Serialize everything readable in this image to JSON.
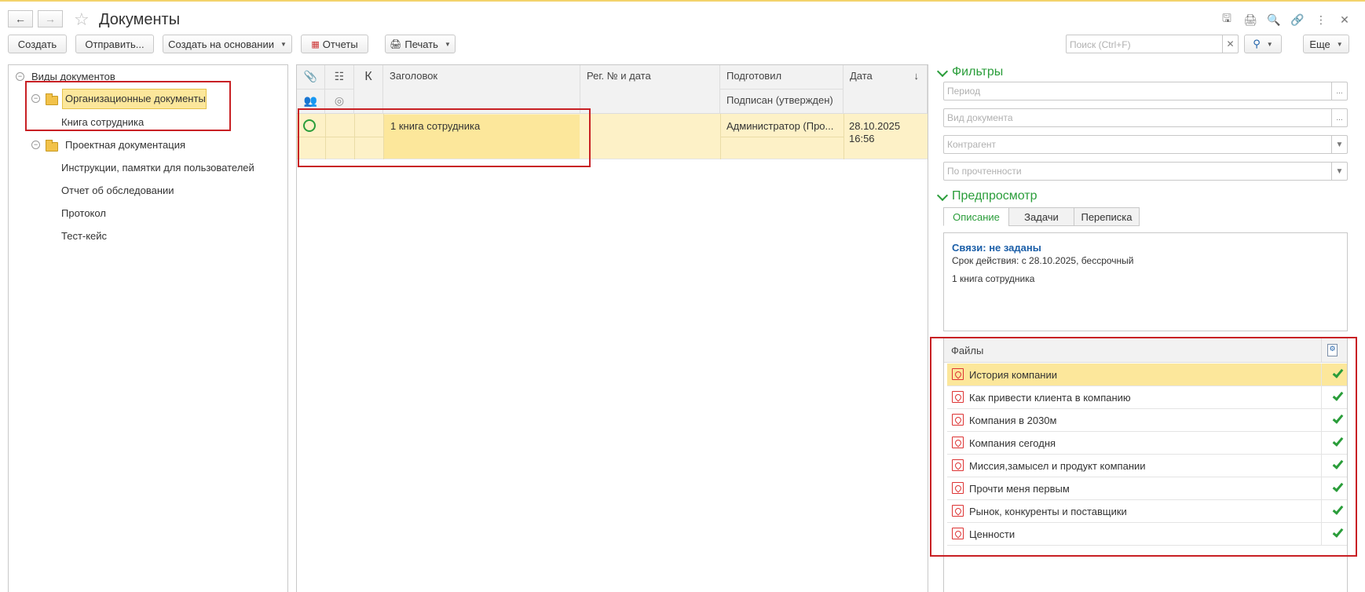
{
  "window": {
    "title": "Документы",
    "back_icon": "arrow-left-icon",
    "forward_icon": "arrow-right-icon",
    "favorite_icon": "star-icon",
    "toolbar_icons": [
      "save-icon",
      "print-icon",
      "preview-icon",
      "link-icon",
      "more-vertical-icon",
      "close-icon"
    ]
  },
  "toolbar": {
    "create": "Создать",
    "send": "Отправить...",
    "create_based": "Создать на основании",
    "reports": "Отчеты",
    "print": "Печать",
    "more": "Еще",
    "search": {
      "placeholder": "Поиск (Ctrl+F)",
      "value": ""
    }
  },
  "tree": {
    "root": "Виды документов",
    "items": [
      {
        "label": "Организационные документы",
        "level": 1,
        "selected": true
      },
      {
        "label": "Книга сотрудника",
        "level": 2
      },
      {
        "label": "Проектная документация",
        "level": 1
      },
      {
        "label": "Инструкции, памятки для пользователей",
        "level": 2
      },
      {
        "label": "Отчет об обследовании",
        "level": 2
      },
      {
        "label": "Протокол",
        "level": 2
      },
      {
        "label": "Тест-кейс",
        "level": 2
      }
    ]
  },
  "list": {
    "columns": {
      "attach_icon": "paperclip-icon",
      "hierarchy_icon": "hierarchy-icon",
      "k": "К",
      "users_icon": "users-icon",
      "circle_icon": "circle-icon",
      "title": "Заголовок",
      "reg": "Рег. № и дата",
      "prepared": "Подготовил",
      "signed": "Подписан (утвержден)",
      "date": "Дата",
      "sort_icon": "sort-down-icon"
    },
    "rows": [
      {
        "icon": "document-status-icon",
        "title": "1 книга сотрудника",
        "reg": "",
        "prepared": "Администратор (Про...",
        "signed": "",
        "date": "28.10.2025",
        "time": "16:56"
      }
    ]
  },
  "filters": {
    "title": "Фильтры",
    "period": {
      "placeholder": "Период"
    },
    "doc_type": {
      "placeholder": "Вид документа"
    },
    "counterparty": {
      "placeholder": "Контрагент"
    },
    "read_state": {
      "placeholder": "По прочтенности"
    }
  },
  "preview": {
    "title": "Предпросмотр",
    "tabs": [
      "Описание",
      "Задачи",
      "Переписка"
    ],
    "active_tab": "Описание",
    "links": "Связи: не заданы",
    "validity": "Срок действия: с 28.10.2025, бессрочный",
    "doc_title": "1 книга сотрудника"
  },
  "files": {
    "header": "Файлы",
    "items": [
      {
        "name": "История компании",
        "selected": true
      },
      {
        "name": "Как привести клиента в компанию"
      },
      {
        "name": "Компания в 2030м"
      },
      {
        "name": "Компания сегодня"
      },
      {
        "name": "Миссия,замысел и продукт компании"
      },
      {
        "name": "Прочти меня первым"
      },
      {
        "name": "Рынок, конкуренты и поставщики"
      },
      {
        "name": "Ценности"
      }
    ]
  },
  "colors": {
    "highlight": "#fce79b",
    "accent_green": "#2a9d3a",
    "annotation_red": "#c82024",
    "link_blue": "#1c5fa8"
  }
}
